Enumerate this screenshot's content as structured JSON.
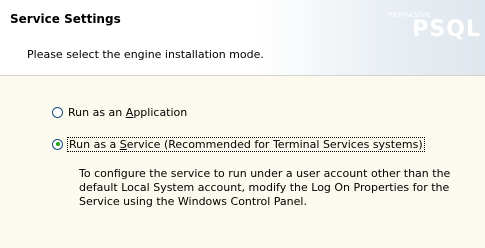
{
  "header": {
    "title": "Service Settings",
    "subtitle": "Please select the engine installation mode.",
    "logo_brand": "PERVASIVE",
    "logo_product": "PSQL"
  },
  "options": [
    {
      "label_pre": "Run as an ",
      "label_accel": "A",
      "label_post": "pplication",
      "selected": false
    },
    {
      "label_pre": "Run as a ",
      "label_accel": "S",
      "label_post": "ervice (Recommended for Terminal Services systems)",
      "selected": true
    }
  ],
  "description": [
    "To configure the service to run under a user account other than the",
    "default Local System account, modify the Log On Properties for the",
    "Service using the Windows Control Panel."
  ],
  "colors": {
    "body_background": "#fcf9ee",
    "radio_dot": "#21a121"
  }
}
